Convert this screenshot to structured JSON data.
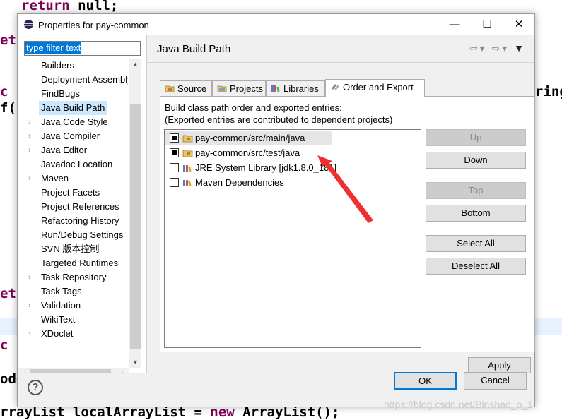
{
  "background_code": {
    "line1_kw": "return",
    "line1_rest": " null;",
    "frag_retu_1": "etu",
    "frag_c_s_1": "c s",
    "frag_paren": "f(p",
    "frag_ring": "ring",
    "frag_retu_2": "etu",
    "frag_c_s_2": "c s",
    "frag_ode": "ode",
    "last_type": "rrayList",
    "last_var": " localArrayList = ",
    "last_kw": "new",
    "last_ctor": " ArrayList();"
  },
  "window": {
    "title": "Properties for pay-common",
    "minimize": "—",
    "maximize": "☐",
    "close": "✕"
  },
  "filter": {
    "text": "type filter text"
  },
  "tree": {
    "items": [
      {
        "label": "Builders",
        "expandable": false
      },
      {
        "label": "Deployment Assembly",
        "expandable": false
      },
      {
        "label": "FindBugs",
        "expandable": false
      },
      {
        "label": "Java Build Path",
        "expandable": false,
        "selected": true
      },
      {
        "label": "Java Code Style",
        "expandable": true
      },
      {
        "label": "Java Compiler",
        "expandable": true
      },
      {
        "label": "Java Editor",
        "expandable": true
      },
      {
        "label": "Javadoc Location",
        "expandable": false
      },
      {
        "label": "Maven",
        "expandable": true
      },
      {
        "label": "Project Facets",
        "expandable": false
      },
      {
        "label": "Project References",
        "expandable": false
      },
      {
        "label": "Refactoring History",
        "expandable": false
      },
      {
        "label": "Run/Debug Settings",
        "expandable": false
      },
      {
        "label": "SVN 版本控制",
        "expandable": false
      },
      {
        "label": "Targeted Runtimes",
        "expandable": false
      },
      {
        "label": "Task Repository",
        "expandable": true
      },
      {
        "label": "Task Tags",
        "expandable": false
      },
      {
        "label": "Validation",
        "expandable": true
      },
      {
        "label": "WikiText",
        "expandable": false
      },
      {
        "label": "XDoclet",
        "expandable": true
      }
    ]
  },
  "page": {
    "title": "Java Build Path",
    "tabs": [
      {
        "label": "Source"
      },
      {
        "label": "Projects"
      },
      {
        "label": "Libraries"
      },
      {
        "label": "Order and Export",
        "active": true
      }
    ],
    "description_line1": "Build class path order and exported entries:",
    "description_line2": "(Exported entries are contributed to dependent projects)",
    "entries": [
      {
        "label": "pay-common/src/main/java",
        "checked": true,
        "highlighted": true,
        "icon": "package-folder-icon"
      },
      {
        "label": "pay-common/src/test/java",
        "checked": true,
        "highlighted": false,
        "icon": "package-folder-icon"
      },
      {
        "label": "JRE System Library [jdk1.8.0_181]",
        "checked": false,
        "highlighted": false,
        "icon": "library-icon"
      },
      {
        "label": "Maven Dependencies",
        "checked": false,
        "highlighted": false,
        "icon": "library-icon"
      }
    ],
    "buttons": {
      "up": "Up",
      "down": "Down",
      "top": "Top",
      "bottom": "Bottom",
      "select_all": "Select All",
      "deselect_all": "Deselect All"
    },
    "apply": "Apply"
  },
  "footer": {
    "help": "?",
    "ok": "OK",
    "cancel": "Cancel"
  },
  "watermark": "https://blog.csdn.net/Binshao_o_1",
  "colors": {
    "selection": "#0078d7",
    "annotation_arrow": "#f03030",
    "keyword": "#7f0055"
  }
}
